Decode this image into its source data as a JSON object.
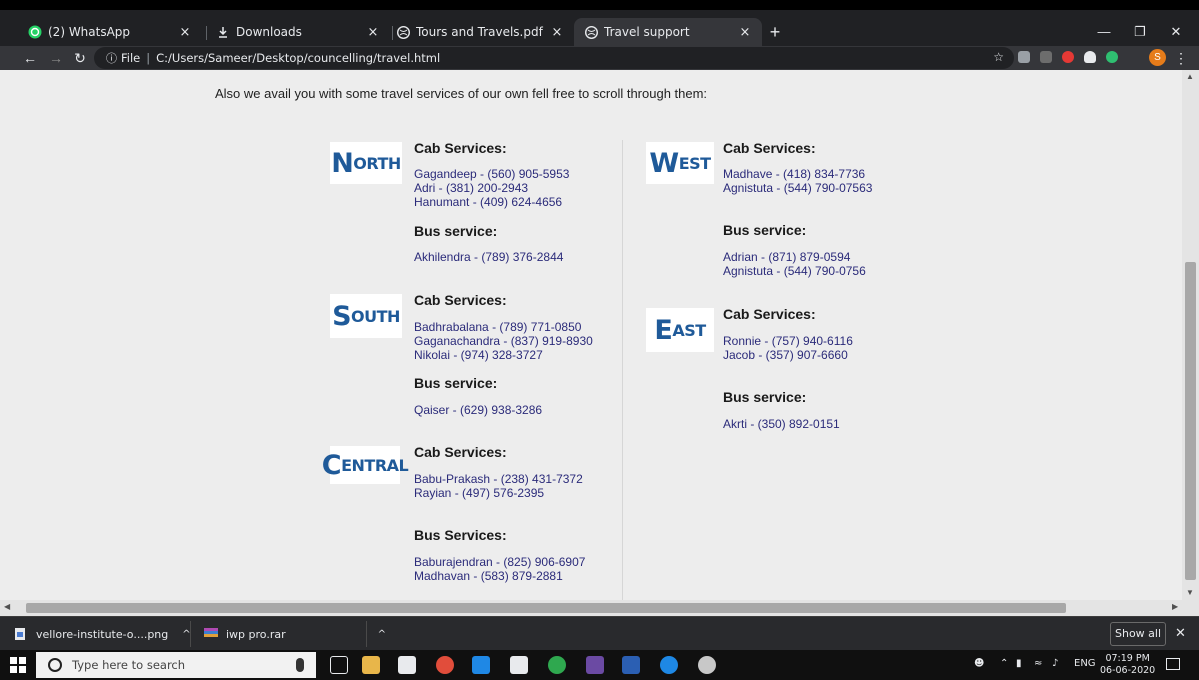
{
  "browser": {
    "tabs": [
      {
        "title": "(2) WhatsApp",
        "icon": "whatsapp-icon",
        "active": false
      },
      {
        "title": "Downloads",
        "icon": "download-icon",
        "active": false
      },
      {
        "title": "Tours and Travels.pdf",
        "icon": "globe-icon",
        "active": false
      },
      {
        "title": "Travel support",
        "icon": "globe-icon",
        "active": true
      }
    ],
    "close_glyph": "×",
    "new_tab_glyph": "+",
    "address": {
      "scheme_label": "File",
      "url": "C:/Users/Sameer/Desktop/councelling/travel.html"
    },
    "profile_initial": "S"
  },
  "page": {
    "intro": "Also we avail you with some travel services of our own fell free to scroll through them:",
    "regions": [
      {
        "name_first": "N",
        "name_rest": "ORTH",
        "cab_heading": "Cab Services:",
        "cab": [
          "Gagandeep - (560) 905-5953",
          "Adri - (381) 200-2943",
          "Hanumant - (409) 624-4656"
        ],
        "bus_heading": "Bus service:",
        "bus": [
          "Akhilendra - (789) 376-2844"
        ]
      },
      {
        "name_first": "S",
        "name_rest": "OUTH",
        "cab_heading": "Cab Services:",
        "cab": [
          "Badhrabalana - (789) 771-0850",
          "Gaganachandra - (837) 919-8930",
          "Nikolai - (974) 328-3727"
        ],
        "bus_heading": "Bus service:",
        "bus": [
          "Qaiser - (629) 938-3286"
        ]
      },
      {
        "name_first": "C",
        "name_rest": "ENTRAL",
        "cab_heading": "Cab Services:",
        "cab": [
          "Babu-Prakash - (238) 431-7372",
          "Rayian - (497) 576-2395"
        ],
        "bus_heading": "Bus Services:",
        "bus": [
          "Baburajendran - (825) 906-6907",
          "Madhavan - (583) 879-2881"
        ]
      },
      {
        "name_first": "W",
        "name_rest": "EST",
        "cab_heading": "Cab Services:",
        "cab": [
          "Madhave - (418) 834-7736",
          "Agnistuta - (544) 790-07563"
        ],
        "bus_heading": "Bus service:",
        "bus": [
          "Adrian - (871) 879-0594",
          "Agnistuta - (544) 790-0756"
        ]
      },
      {
        "name_first": "E",
        "name_rest": "AST",
        "cab_heading": "Cab Services:",
        "cab": [
          "Ronnie - (757) 940-6116",
          "Jacob - (357) 907-6660"
        ],
        "bus_heading": "Bus service:",
        "bus": [
          "Akrti - (350) 892-0151"
        ]
      }
    ]
  },
  "downloads": {
    "items": [
      {
        "name": "vellore-institute-o....png",
        "icon": "image-file-icon"
      },
      {
        "name": "iwp pro.rar",
        "icon": "archive-file-icon"
      }
    ],
    "show_all": "Show all"
  },
  "taskbar": {
    "search_placeholder": "Type here to search",
    "language": "ENG",
    "time": "07:19 PM",
    "date": "06-06-2020"
  },
  "colors": {
    "region_logo": "#1f5a99",
    "contact_text": "#2b2b7a",
    "page_bg": "#ededed"
  }
}
